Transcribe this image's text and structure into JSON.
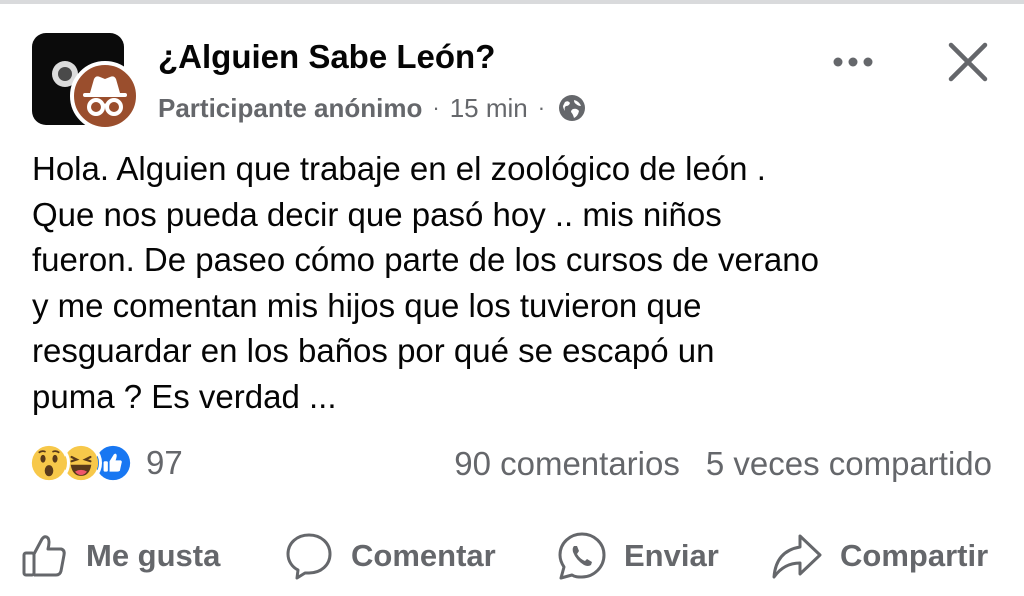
{
  "post": {
    "group_name": "¿Alguien Sabe León?",
    "author": "Participante anónimo",
    "separator": "·",
    "time": "15 min",
    "privacy_icon": "globe-icon",
    "text_lines": [
      "Hola. Alguien que trabaje en el zoológico de león .",
      "Que nos pueda decir que pasó hoy .. mis niños",
      "fueron. De paseo cómo parte de los cursos de verano",
      "y me comentan mis hijos que los tuvieron que",
      "resguardar en los baños por qué se escapó un",
      "puma ? Es verdad ..."
    ]
  },
  "header_icons": {
    "more": "more-icon",
    "close": "close-icon"
  },
  "stats": {
    "reaction_icons": [
      "wow-reaction-icon",
      "haha-reaction-icon",
      "like-reaction-icon"
    ],
    "reaction_count": "97",
    "comments": "90 comentarios",
    "shares": "5 veces compartido"
  },
  "actions": {
    "like": "Me gusta",
    "comment": "Comentar",
    "send": "Enviar",
    "share": "Compartir"
  },
  "colors": {
    "text": "#050505",
    "secondary": "#65676b",
    "like_blue": "#1877f2",
    "reaction_yellow": "#f7c84a",
    "anon_avatar": "#9a4e2d"
  }
}
